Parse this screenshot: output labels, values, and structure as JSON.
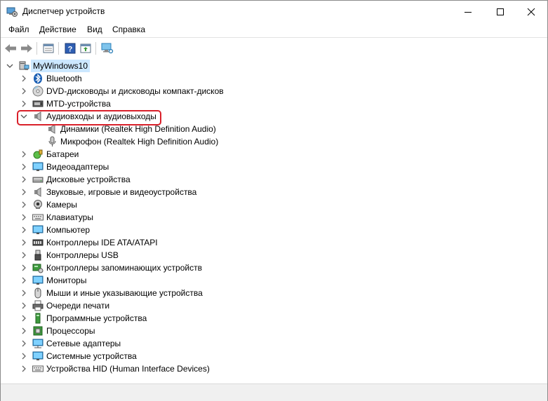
{
  "window": {
    "title": "Диспетчер устройств"
  },
  "menu": {
    "file": "Файл",
    "action": "Действие",
    "view": "Вид",
    "help": "Справка"
  },
  "tree": {
    "root": "MyWindows10",
    "items": [
      {
        "label": "Bluetooth",
        "icon": "bluetooth-icon"
      },
      {
        "label": "DVD-дисководы и дисководы компакт-дисков",
        "icon": "dvd-drive-icon"
      },
      {
        "label": "MTD-устройства",
        "icon": "mtd-device-icon"
      },
      {
        "label": "Аудиовходы и аудиовыходы",
        "icon": "audio-io-icon",
        "expanded": true,
        "children": [
          {
            "label": "Динамики (Realtek High Definition Audio)",
            "icon": "speaker-icon"
          },
          {
            "label": "Микрофон (Realtek High Definition Audio)",
            "icon": "microphone-icon"
          }
        ]
      },
      {
        "label": "Батареи",
        "icon": "battery-icon"
      },
      {
        "label": "Видеоадаптеры",
        "icon": "display-adapter-icon"
      },
      {
        "label": "Дисковые устройства",
        "icon": "disk-drive-icon"
      },
      {
        "label": "Звуковые, игровые и видеоустройства",
        "icon": "sound-device-icon"
      },
      {
        "label": "Камеры",
        "icon": "camera-icon"
      },
      {
        "label": "Клавиатуры",
        "icon": "keyboard-icon"
      },
      {
        "label": "Компьютер",
        "icon": "computer-icon"
      },
      {
        "label": "Контроллеры IDE ATA/ATAPI",
        "icon": "ide-controller-icon"
      },
      {
        "label": "Контроллеры USB",
        "icon": "usb-icon"
      },
      {
        "label": "Контроллеры запоминающих устройств",
        "icon": "storage-controller-icon"
      },
      {
        "label": "Мониторы",
        "icon": "monitor-icon"
      },
      {
        "label": "Мыши и иные указывающие устройства",
        "icon": "mouse-icon"
      },
      {
        "label": "Очереди печати",
        "icon": "printer-icon"
      },
      {
        "label": "Программные устройства",
        "icon": "software-device-icon"
      },
      {
        "label": "Процессоры",
        "icon": "processor-icon"
      },
      {
        "label": "Сетевые адаптеры",
        "icon": "network-adapter-icon"
      },
      {
        "label": "Системные устройства",
        "icon": "system-device-icon"
      },
      {
        "label": "Устройства HID (Human Interface Devices)",
        "icon": "hid-icon"
      }
    ]
  },
  "colors": {
    "highlight": "#d9202a",
    "selection": "#cce8ff"
  }
}
